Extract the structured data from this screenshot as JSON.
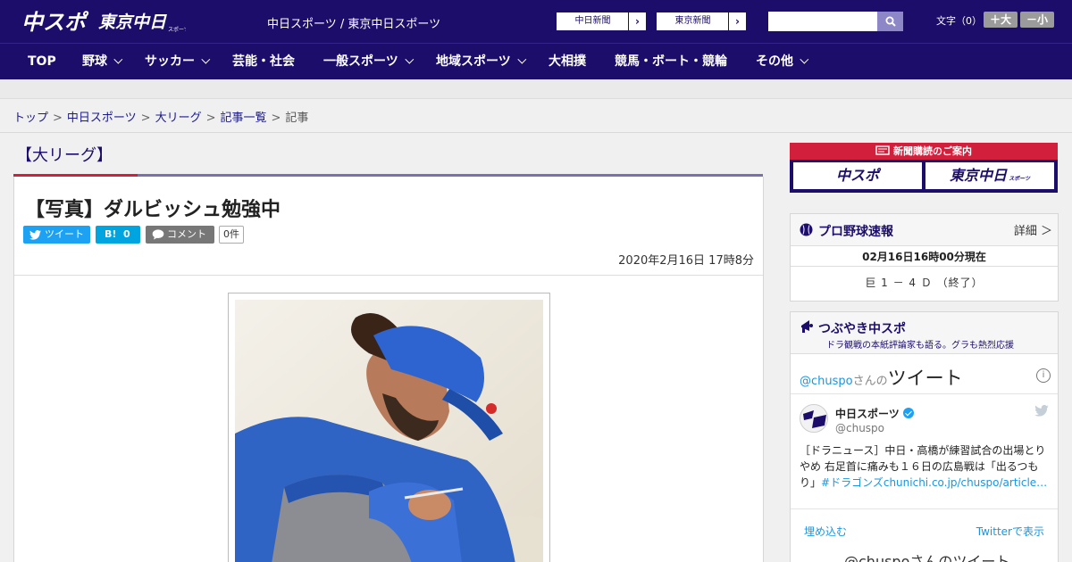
{
  "header": {
    "logo_main": "中スポ",
    "logo_tokyo": "東京中日",
    "logo_tokyo_sub": "スポーツ",
    "sites": "中日スポーツ / 東京中日スポーツ",
    "paper_buttons": [
      "中日新聞",
      "東京新聞"
    ],
    "search": {
      "placeholder": ""
    },
    "font_size_label": "文字（0）",
    "font_larger": "＋大",
    "font_smaller": "－小"
  },
  "nav": {
    "items": [
      {
        "label": "TOP",
        "has_menu": false
      },
      {
        "label": "野球",
        "has_menu": true
      },
      {
        "label": "サッカー",
        "has_menu": true
      },
      {
        "label": "芸能・社会",
        "has_menu": false
      },
      {
        "label": "一般スポーツ",
        "has_menu": true
      },
      {
        "label": "地域スポーツ",
        "has_menu": true
      },
      {
        "label": "大相撲",
        "has_menu": false
      },
      {
        "label": "競馬・ボート・競輪",
        "has_menu": false
      },
      {
        "label": "その他",
        "has_menu": true
      }
    ]
  },
  "breadcrumb": {
    "items": [
      "トップ",
      "中日スポーツ",
      "大リーグ",
      "記事一覧"
    ],
    "current": "記事"
  },
  "article": {
    "category": "【大リーグ】",
    "title": "【写真】ダルビッシュ勉強中",
    "tweet_label": "ツイート",
    "hatena_label": "B!",
    "hatena_count": "0",
    "comment_label": "コメント",
    "comment_count": "0件",
    "date": "2020年2月16日 17時8分"
  },
  "sidebar": {
    "subscribe": {
      "title": "新聞購読のご案内",
      "cards": [
        "中スポ",
        "東京中日"
      ],
      "card_sub": "スポーツ"
    },
    "score": {
      "title": "プロ野球速報",
      "detail_label": "詳細 ＞",
      "timestamp": "02月16日16時00分現在",
      "result": "巨 1 － 4 Ｄ （終了）"
    },
    "tsubuyaki": {
      "title": "つぶやき中スポ",
      "subtitle": "ドラ観戦の本紙評論家も語る。グラも熱烈応援",
      "handle": "@chuspo",
      "san": "さんの",
      "tweet_word": "ツイート",
      "account_name": "中日スポーツ",
      "account_user": "@chuspo",
      "tweet_text_plain": "［ドラニュース］中日・高橋が練習試合の出場とりやめ 右足首に痛みも１６日の広島戦は「出るつもり」",
      "tweet_hashtag": "#ドラゴンズ",
      "tweet_link": "chunichi.co.jp/chuspo/article…",
      "embed_label": "埋め込む",
      "view_label": "Twitterで表示",
      "footer_title": "@chuspoさんのツイート"
    }
  },
  "colors": {
    "brand_navy": "#1d0d6b",
    "brand_red": "#d21f3c",
    "twitter_blue": "#1da1f2"
  }
}
